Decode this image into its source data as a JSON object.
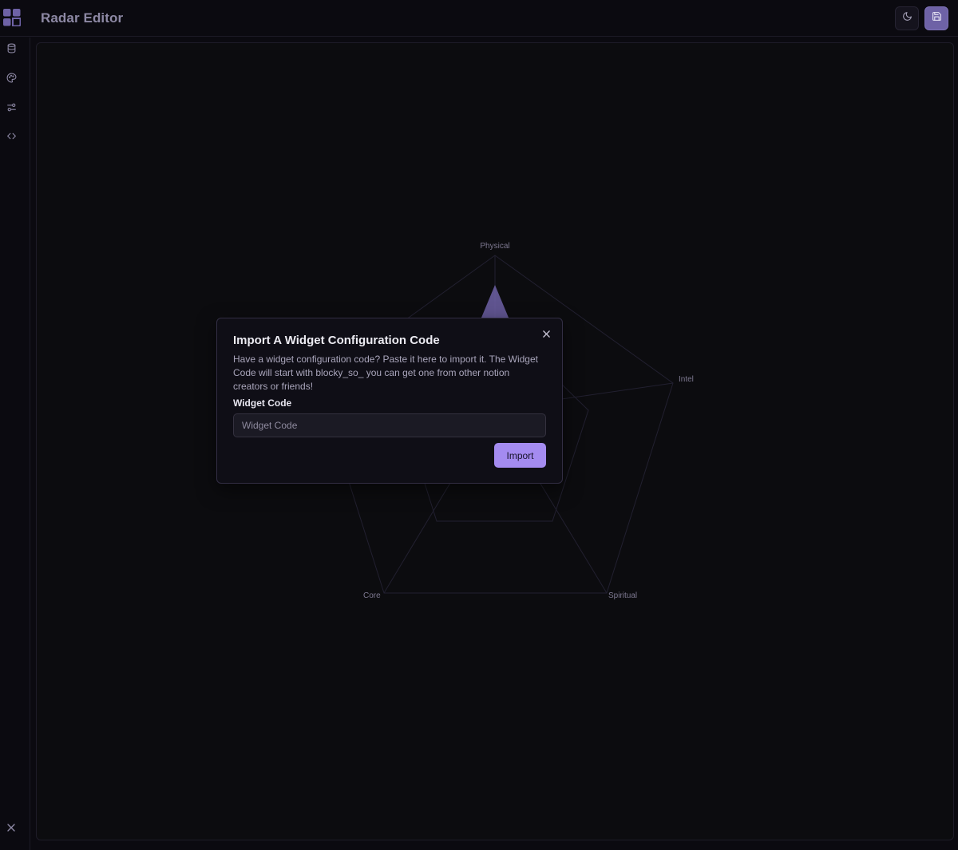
{
  "header": {
    "title": "Radar Editor"
  },
  "icons": {
    "logo": "blocky-logo-icon",
    "theme": "moon-icon",
    "save": "floppy-disk-icon",
    "sidebar": [
      "database-icon",
      "palette-icon",
      "sliders-icon",
      "code-icon"
    ],
    "collapse": "close-icon"
  },
  "chart_data": {
    "type": "radar",
    "categories": [
      "Physical",
      "Intel",
      "Spiritual",
      "Core"
    ],
    "grid": true
  },
  "modal": {
    "title": "Import A Widget Configuration Code",
    "description": "Have a widget configuration code? Paste it here to import it. The Widget Code will start with blocky_so_ you can get one from other notion creators or friends!",
    "field_label": "Widget Code",
    "input_placeholder": "Widget Code",
    "input_value": "",
    "import_label": "Import"
  },
  "colors": {
    "background": "#0b0a10",
    "accent": "#a48bf0",
    "save_button": "#6e62a6",
    "radar_fill": "#6e62a6"
  }
}
